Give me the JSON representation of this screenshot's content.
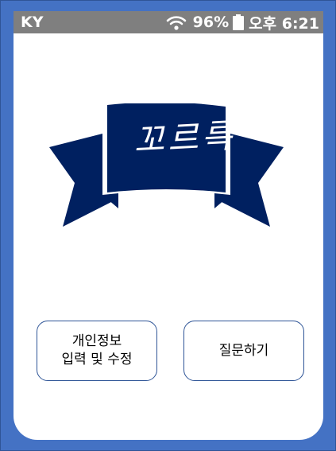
{
  "status_bar": {
    "carrier": "KY",
    "battery_percent": "96%",
    "time": "오후 6:21"
  },
  "logo": {
    "text": "꼬르륵",
    "color": "#002060"
  },
  "buttons": {
    "profile_line1": "개인정보",
    "profile_line2": "입력 및 수정",
    "ask": "질문하기"
  },
  "colors": {
    "background": "#4472c4",
    "status_bar": "#7f7f7f",
    "button_border": "#2f5597",
    "ribbon": "#002060"
  }
}
